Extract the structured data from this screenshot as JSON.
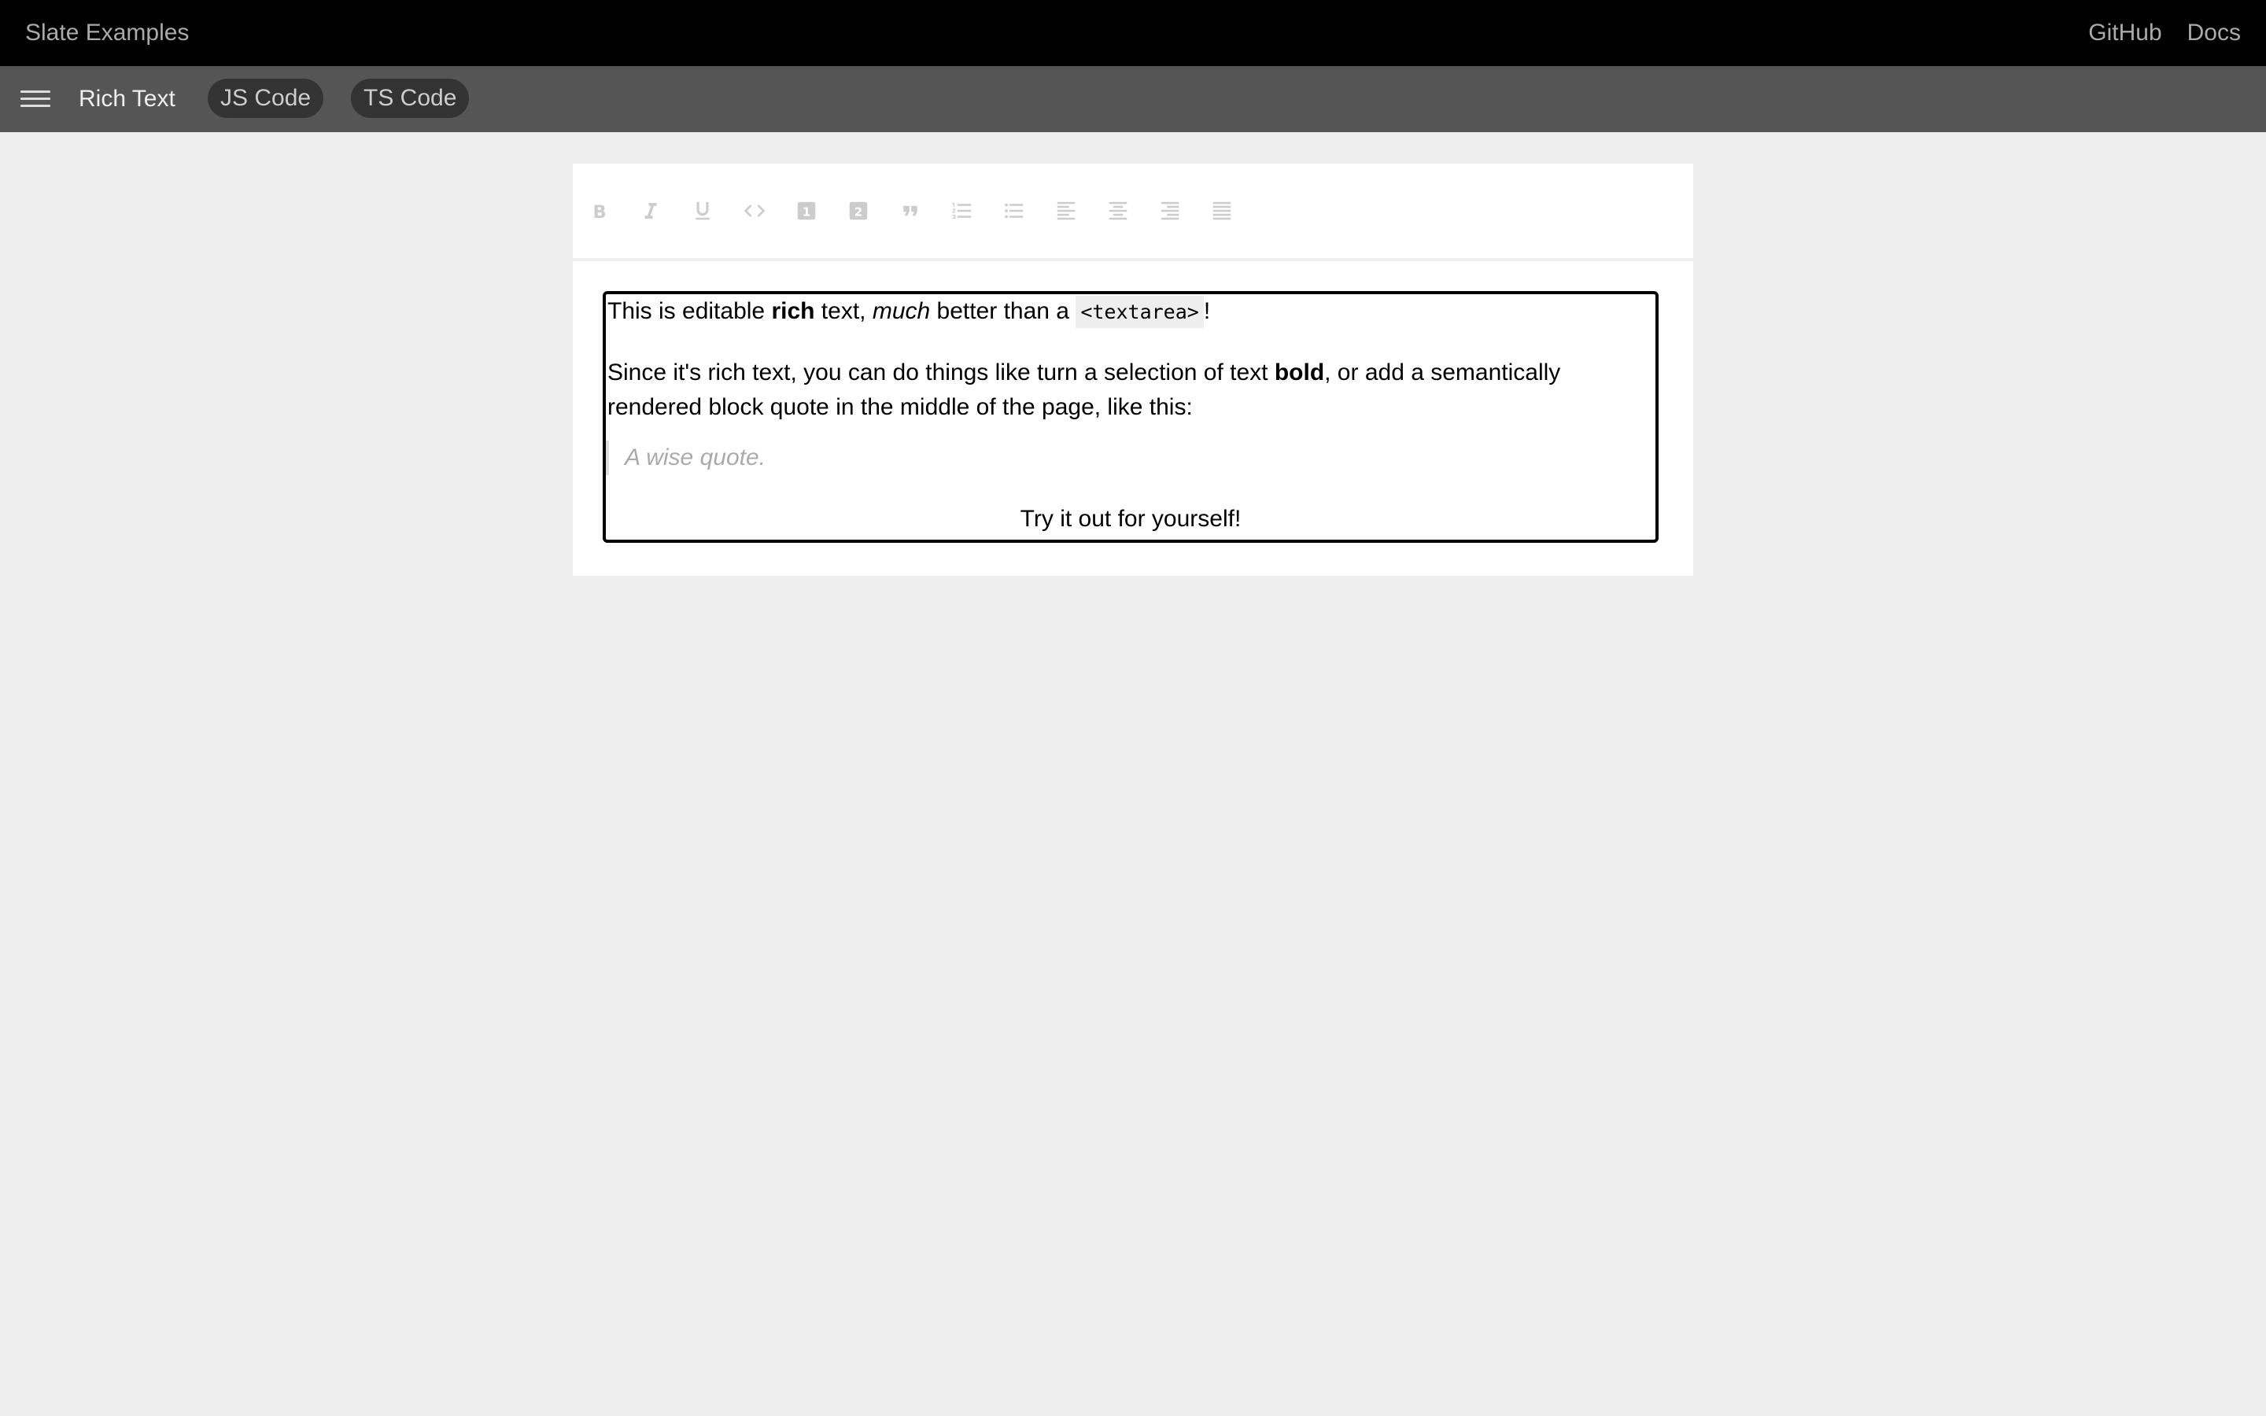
{
  "header": {
    "brand": "Slate Examples",
    "links": [
      "GitHub",
      "Docs"
    ]
  },
  "subheader": {
    "menu_icon": "hamburger-menu-icon",
    "title": "Rich Text",
    "js_code": "JS Code",
    "ts_code": "TS Code"
  },
  "toolbar": {
    "buttons": [
      {
        "icon": "format-bold-icon",
        "glyph": "B"
      },
      {
        "icon": "format-italic-icon",
        "glyph": "I"
      },
      {
        "icon": "format-underline-icon",
        "glyph": "U"
      },
      {
        "icon": "code-icon",
        "glyph": "<>"
      },
      {
        "icon": "heading-one-icon",
        "glyph": "1"
      },
      {
        "icon": "heading-two-icon",
        "glyph": "2"
      },
      {
        "icon": "block-quote-icon",
        "glyph": "❞"
      },
      {
        "icon": "numbered-list-icon",
        "glyph": ""
      },
      {
        "icon": "bulleted-list-icon",
        "glyph": ""
      },
      {
        "icon": "align-left-icon",
        "glyph": ""
      },
      {
        "icon": "align-center-icon",
        "glyph": ""
      },
      {
        "icon": "align-right-icon",
        "glyph": ""
      },
      {
        "icon": "align-justify-icon",
        "glyph": ""
      }
    ],
    "icon_color": "#cccccc"
  },
  "editor": {
    "p1": {
      "t1": "This is editable ",
      "bold": "rich",
      "t2": " text, ",
      "italic": "much",
      "t3": " better than a ",
      "code": "<textarea>",
      "t4": "!"
    },
    "p2": {
      "t1": "Since it's rich text, you can do things like turn a selection of text ",
      "bold": "bold",
      "t2": ", or add a semantically"
    },
    "p3": "rendered block quote in the middle of the page, like this:",
    "quote": "A wise quote.",
    "center": "Try it out for yourself!"
  }
}
